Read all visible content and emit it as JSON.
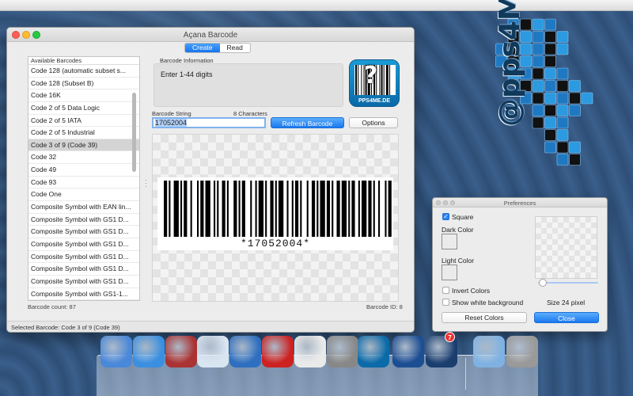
{
  "window": {
    "title": "Açana Barcode",
    "tabs": [
      {
        "label": "Create",
        "active": true
      },
      {
        "label": "Read",
        "active": false
      }
    ]
  },
  "list": {
    "header": "Available Barcodes",
    "items": [
      "Code 128 (automatic subset s...",
      "Code 128 (Subset B)",
      "Code 16K",
      "Code 2 of 5 Data Logic",
      "Code 2 of 5 IATA",
      "Code 2 of 5 Industrial",
      "Code 3 of 9 (Code 39)",
      "Code 32",
      "Code 49",
      "Code 93",
      "Code One",
      "Composite Symbol with EAN lin...",
      "Composite Symbol with GS1 D...",
      "Composite Symbol with GS1 D...",
      "Composite Symbol with GS1 D...",
      "Composite Symbol with GS1 D...",
      "Composite Symbol with GS1 D...",
      "Composite Symbol with GS1 D...",
      "Composite Symbol with GS1-1..."
    ],
    "selected_index": 6,
    "count_label": "Barcode count: 87"
  },
  "info": {
    "group_label": "Barcode Information",
    "text": "Enter 1-44 digits"
  },
  "logo": {
    "text": "PPS4ME.DE",
    "glyph": "?"
  },
  "barcode_string": {
    "label": "Barcode String",
    "chars_label": "8 Characters",
    "value": "17052004"
  },
  "buttons": {
    "refresh": "Refresh Barcode",
    "options": "Options"
  },
  "preview": {
    "human_readable": "*17052004*",
    "barcode_id": "Barcode ID: 8"
  },
  "status": "Selected Barcode: Code 3 of 9 (Code 39)",
  "preferences": {
    "title": "Preferences",
    "square_label": "Square",
    "square_checked": true,
    "dark_color_label": "Dark Color",
    "light_color_label": "Light Color",
    "invert_label": "Invert Colors",
    "invert_checked": false,
    "white_bg_label": "Show white background",
    "white_bg_checked": false,
    "size_label": "Size 24 pixel",
    "size_level": 0.0,
    "reset_button": "Reset Colors",
    "close_button": "Close"
  },
  "branding": {
    "text": "@pps4Me"
  },
  "dock": {
    "badge": "7",
    "icons": [
      "finder-icon",
      "safari-icon",
      "guarantee-icon",
      "car-icon",
      "globe-icon",
      "acrobat-icon",
      "qr-lite-icon",
      "flashdrive-icon",
      "barcode-app-icon",
      "handshake-icon",
      "star-app-icon",
      "folder-icon",
      "trash-icon"
    ]
  },
  "colors": {
    "accent": "#1f7bf0",
    "selection": "#d4d4d4"
  }
}
